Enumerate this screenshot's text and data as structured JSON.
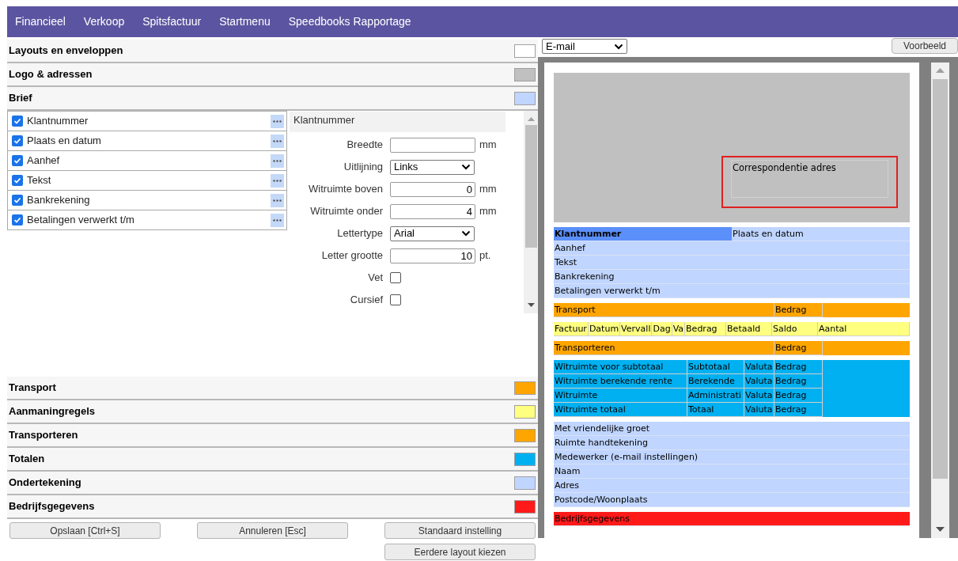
{
  "menu": [
    {
      "label": "Financieel"
    },
    {
      "label": "Verkoop"
    },
    {
      "label": "Spitsfactuur"
    },
    {
      "label": "Startmenu"
    },
    {
      "label": "Speedbooks Rapportage"
    }
  ],
  "sections_top": [
    {
      "title": "Layouts en enveloppen",
      "color": "#ffffff"
    },
    {
      "title": "Logo & adressen",
      "color": "#c0c0c0"
    },
    {
      "title": "Brief",
      "color": "#c0d5ff"
    }
  ],
  "items": [
    {
      "label": "Klantnummer",
      "checked": true
    },
    {
      "label": "Plaats en datum",
      "checked": true
    },
    {
      "label": "Aanhef",
      "checked": true
    },
    {
      "label": "Tekst",
      "checked": true
    },
    {
      "label": "Bankrekening",
      "checked": true
    },
    {
      "label": "Betalingen verwerkt t/m",
      "checked": true
    }
  ],
  "settings": {
    "title": "Klantnummer",
    "fields": [
      {
        "kind": "input",
        "label": "Breedte",
        "unit": "mm"
      },
      {
        "kind": "select",
        "label": "Uitlijning",
        "value": "Links"
      },
      {
        "kind": "input",
        "label": "Witruimte boven",
        "value": "0",
        "unit": "mm"
      },
      {
        "kind": "input",
        "label": "Witruimte onder",
        "value": "4",
        "unit": "mm"
      },
      {
        "kind": "select",
        "label": "Lettertype",
        "value": "Arial"
      },
      {
        "kind": "input",
        "label": "Letter grootte",
        "value": "10",
        "unit": "pt."
      },
      {
        "kind": "checkbox",
        "label": "Vet",
        "checked": false
      },
      {
        "kind": "checkbox",
        "label": "Cursief",
        "checked": false
      }
    ]
  },
  "sections_bottom": [
    {
      "title": "Transport",
      "color": "#ffa500"
    },
    {
      "title": "Aanmaningregels",
      "color": "#ffff80"
    },
    {
      "title": "Transporteren",
      "color": "#ffa500"
    },
    {
      "title": "Totalen",
      "color": "#00b0f0"
    },
    {
      "title": "Ondertekening",
      "color": "#c0d5ff"
    },
    {
      "title": "Bedrijfsgegevens",
      "color": "#ff1a1a"
    }
  ],
  "buttons": [
    {
      "label": "Opslaan [Ctrl+S]"
    },
    {
      "label": "Annuleren [Esc]"
    },
    {
      "label": "Standaard instelling"
    },
    {
      "label": "Eerdere layout kiezen"
    }
  ],
  "preview": {
    "output": "E-mail",
    "button": "Voorbeeld",
    "address": "Correspondentie adres",
    "blocks": [
      {
        "kind": "letter",
        "color": "#c0d5ff",
        "rows": [
          [
            {
              "text": "Klantnummer",
              "selected": true
            },
            {
              "text": "Plaats en datum",
              "selected": false
            }
          ],
          [
            {
              "text": "Aanhef",
              "selected": false
            }
          ],
          [
            {
              "text": "Tekst",
              "selected": false
            }
          ],
          [
            {
              "text": "Bankrekening",
              "selected": false
            }
          ],
          [
            {
              "text": "Betalingen verwerkt t/m",
              "selected": false
            }
          ]
        ]
      },
      {
        "kind": "transport",
        "color": "#ffa500",
        "rows": [
          [
            {
              "text": "Transport"
            },
            {
              "text": "Bedrag"
            }
          ]
        ]
      },
      {
        "kind": "lines",
        "color": "#ffff80",
        "rows": [
          [
            {
              "text": "Factuur"
            },
            {
              "text": "Datum"
            },
            {
              "text": "Vervall"
            },
            {
              "text": "Dag"
            },
            {
              "text": "Va"
            },
            {
              "text": "Bedrag"
            },
            {
              "text": "Betaald"
            },
            {
              "text": "Saldo"
            },
            {
              "text": "Aantal"
            }
          ]
        ]
      },
      {
        "kind": "transport",
        "color": "#ffa500",
        "rows": [
          [
            {
              "text": "Transporteren"
            },
            {
              "text": "Bedrag"
            }
          ]
        ]
      },
      {
        "kind": "totals",
        "color": "#00b0f0",
        "rows": [
          [
            {
              "text": "Witruimte voor subtotaal"
            },
            {
              "text": "Subtotaal"
            },
            {
              "text": "Valuta"
            },
            {
              "text": "Bedrag"
            }
          ],
          [
            {
              "text": "Witruimte berekende rente"
            },
            {
              "text": "Berekende"
            },
            {
              "text": "Valuta"
            },
            {
              "text": "Bedrag"
            }
          ],
          [
            {
              "text": "Witruimte"
            },
            {
              "text": "Administrati"
            },
            {
              "text": "Valuta"
            },
            {
              "text": "Bedrag"
            }
          ],
          [
            {
              "text": "Witruimte totaal"
            },
            {
              "text": "Totaal"
            },
            {
              "text": "Valuta"
            },
            {
              "text": "Bedrag"
            }
          ]
        ]
      },
      {
        "kind": "letter",
        "color": "#c0d5ff",
        "rows": [
          [
            {
              "text": "Met vriendelijke groet"
            }
          ],
          [
            {
              "text": "Ruimte handtekening"
            }
          ],
          [
            {
              "text": "Medewerker (e-mail instellingen)"
            }
          ],
          [
            {
              "text": "Naam"
            }
          ],
          [
            {
              "text": "Adres"
            }
          ],
          [
            {
              "text": "Postcode/Woonplaats"
            }
          ]
        ]
      },
      {
        "kind": "letter",
        "color": "#ff1a1a",
        "rows": [
          [
            {
              "text": "Bedrijfsgegevens"
            }
          ]
        ]
      }
    ]
  }
}
